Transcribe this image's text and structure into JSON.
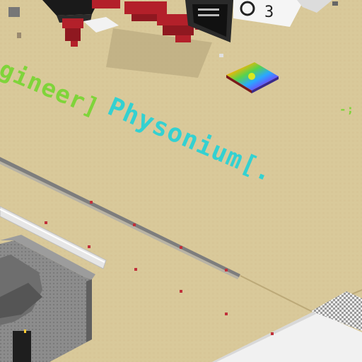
{
  "scene": {
    "title": "Isometric voxel sandbox view",
    "ground_color": "#d9c99a",
    "palette": {
      "sand": "#d9c99a",
      "sand_dark": "#c8b684",
      "stone": "#8a8a8a",
      "stone_dark": "#5f5f5f",
      "snow": "#f1f1f1",
      "text_green": "#7fd43a",
      "text_cyan": "#33d1d1",
      "red_block": "#b3202a",
      "black_block": "#1a1a1a"
    }
  },
  "floor_text": {
    "green_label": "gineer]",
    "cyan_label": "Physonium[.",
    "small_green_mark": "-;"
  },
  "objects": {
    "rainbow_tile": "rainbow-pattern-tile",
    "building": "gray-stone-building",
    "pipe": "white-pipe",
    "road": "gray-road-line",
    "snow_area": "snow-platform",
    "red_structures": "red-block-structures",
    "monitor": "display-screen",
    "flowers": "small-red-flowers"
  }
}
